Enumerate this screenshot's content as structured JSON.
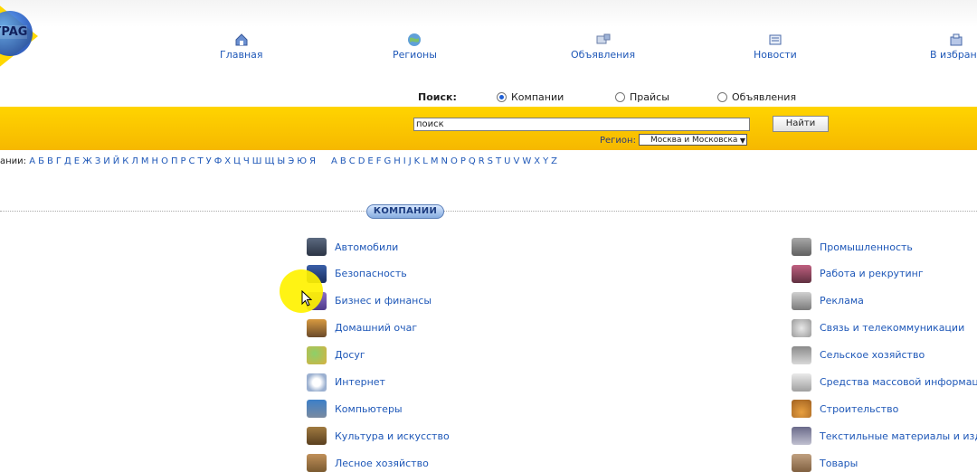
{
  "logo": {
    "text": "YPAG"
  },
  "nav": [
    {
      "label": "Главная",
      "icon": "home-icon"
    },
    {
      "label": "Регионы",
      "icon": "globe-icon"
    },
    {
      "label": "Объявления",
      "icon": "ads-icon"
    },
    {
      "label": "Новости",
      "icon": "news-icon"
    },
    {
      "label": "В избранн",
      "icon": "favorites-icon"
    }
  ],
  "search": {
    "label": "Поиск:",
    "options": [
      {
        "label": "Компании",
        "selected": true
      },
      {
        "label": "Прайсы",
        "selected": false
      },
      {
        "label": "Объявления",
        "selected": false
      }
    ],
    "input_value": "поиск",
    "button_label": "Найти",
    "region_label": "Регион:",
    "region_value": "Москва и Московска"
  },
  "alphabet": {
    "prefix": "ании:",
    "cyrillic": [
      "А",
      "Б",
      "В",
      "Г",
      "Д",
      "Е",
      "Ж",
      "З",
      "И",
      "Й",
      "К",
      "Л",
      "М",
      "Н",
      "О",
      "П",
      "Р",
      "С",
      "Т",
      "У",
      "Ф",
      "Х",
      "Ц",
      "Ч",
      "Ш",
      "Щ",
      "Ы",
      "Э",
      "Ю",
      "Я"
    ],
    "latin": [
      "A",
      "B",
      "C",
      "D",
      "E",
      "F",
      "G",
      "H",
      "I",
      "J",
      "K",
      "L",
      "M",
      "N",
      "O",
      "P",
      "Q",
      "R",
      "S",
      "T",
      "U",
      "V",
      "W",
      "X",
      "Y",
      "Z"
    ]
  },
  "section_tab": "КОМПАНИИ",
  "categories_left": [
    {
      "label": "Автомобили",
      "icon": "car-icon"
    },
    {
      "label": "Безопасность",
      "icon": "safe-icon"
    },
    {
      "label": "Бизнес и финансы",
      "icon": "money-icon"
    },
    {
      "label": "Домашний очаг",
      "icon": "home-goods-icon"
    },
    {
      "label": "Досуг",
      "icon": "balloons-icon"
    },
    {
      "label": "Интернет",
      "icon": "at-sign-icon"
    },
    {
      "label": "Компьютеры",
      "icon": "monitor-icon"
    },
    {
      "label": "Культура и искусство",
      "icon": "painting-icon"
    },
    {
      "label": "Лесное хозяйство",
      "icon": "wood-icon"
    }
  ],
  "categories_right": [
    {
      "label": "Промышленность",
      "icon": "factory-icon"
    },
    {
      "label": "Работа и рекрутинг",
      "icon": "people-icon"
    },
    {
      "label": "Реклама",
      "icon": "megaphone-icon"
    },
    {
      "label": "Связь и телекоммуникации",
      "icon": "satellite-dish-icon"
    },
    {
      "label": "Сельское хозяйство",
      "icon": "agriculture-icon"
    },
    {
      "label": "Средства массовой информации",
      "icon": "newspaper-icon"
    },
    {
      "label": "Строительство",
      "icon": "hard-hat-icon"
    },
    {
      "label": "Текстильные материалы и издели",
      "icon": "textile-icon"
    },
    {
      "label": "Товары",
      "icon": "goods-icon"
    }
  ]
}
